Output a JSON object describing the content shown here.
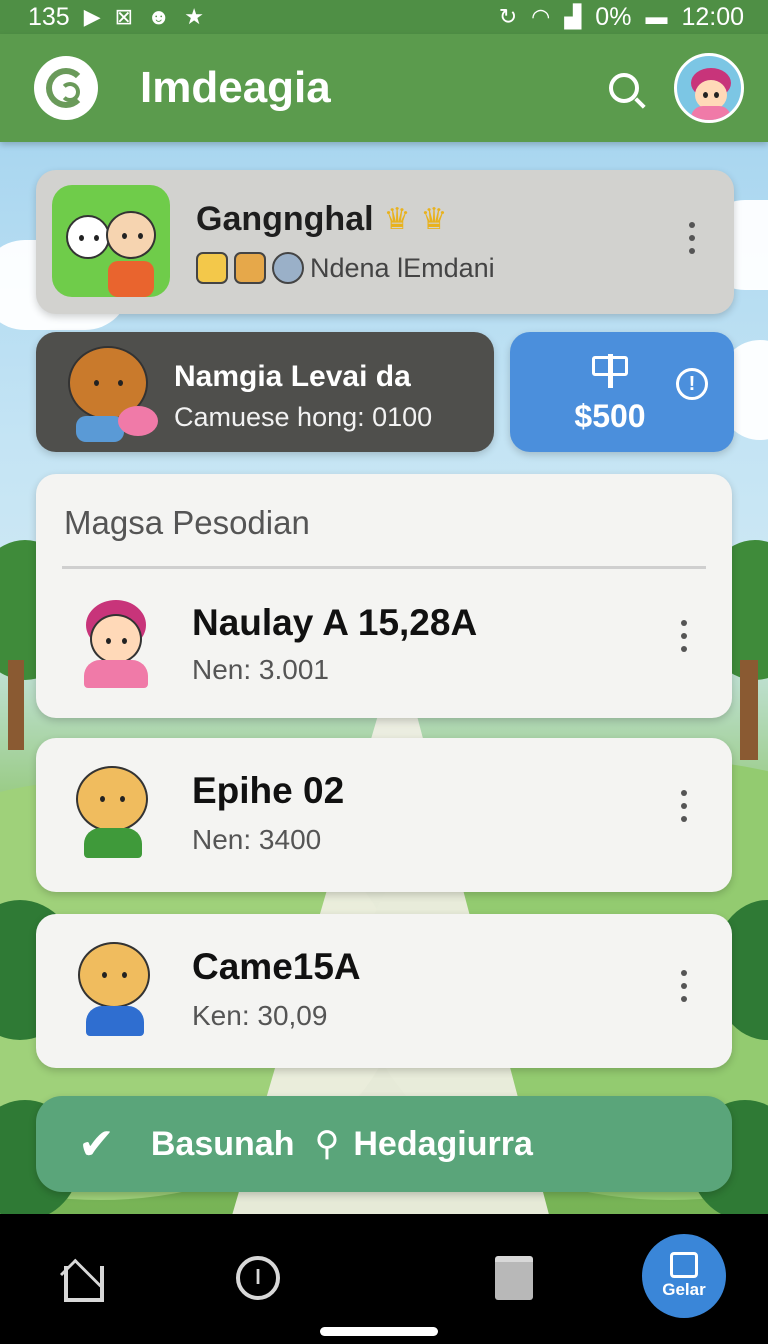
{
  "status_bar": {
    "left_number": "135",
    "icons_left": [
      "play-icon",
      "close-box-icon",
      "face-icon",
      "star-icon"
    ],
    "icons_right": [
      "sync-icon",
      "wifi-icon",
      "signal-icon"
    ],
    "battery": "0%",
    "time": "12:00"
  },
  "app_bar": {
    "title": "Imdeagia"
  },
  "profile": {
    "name": "Gangnghal",
    "crowns": [
      "♛",
      "♛"
    ],
    "subtitle": "Ndena lEmdani"
  },
  "level": {
    "title": "Namgia Levai da",
    "subtitle": "Camuese hong: 0100"
  },
  "money": {
    "amount": "$500",
    "info": "!"
  },
  "list": {
    "header": "Magsa Pesodian",
    "items": [
      {
        "name": "Naulay A 15,28A",
        "sub": "Nen: 3.001"
      },
      {
        "name": "Epihe 02",
        "sub": "Nen: 3400"
      },
      {
        "name": "Came15A",
        "sub": "Ken: 30,09"
      }
    ]
  },
  "action": {
    "label_1": "Basunah",
    "label_2": "Hedagiurra"
  },
  "bottom_nav": {
    "fab_label": "Gelar"
  },
  "colors": {
    "app_bar": "#5b9b4d",
    "money_card": "#4b8fdc",
    "action_bar": "#5aa57a"
  }
}
